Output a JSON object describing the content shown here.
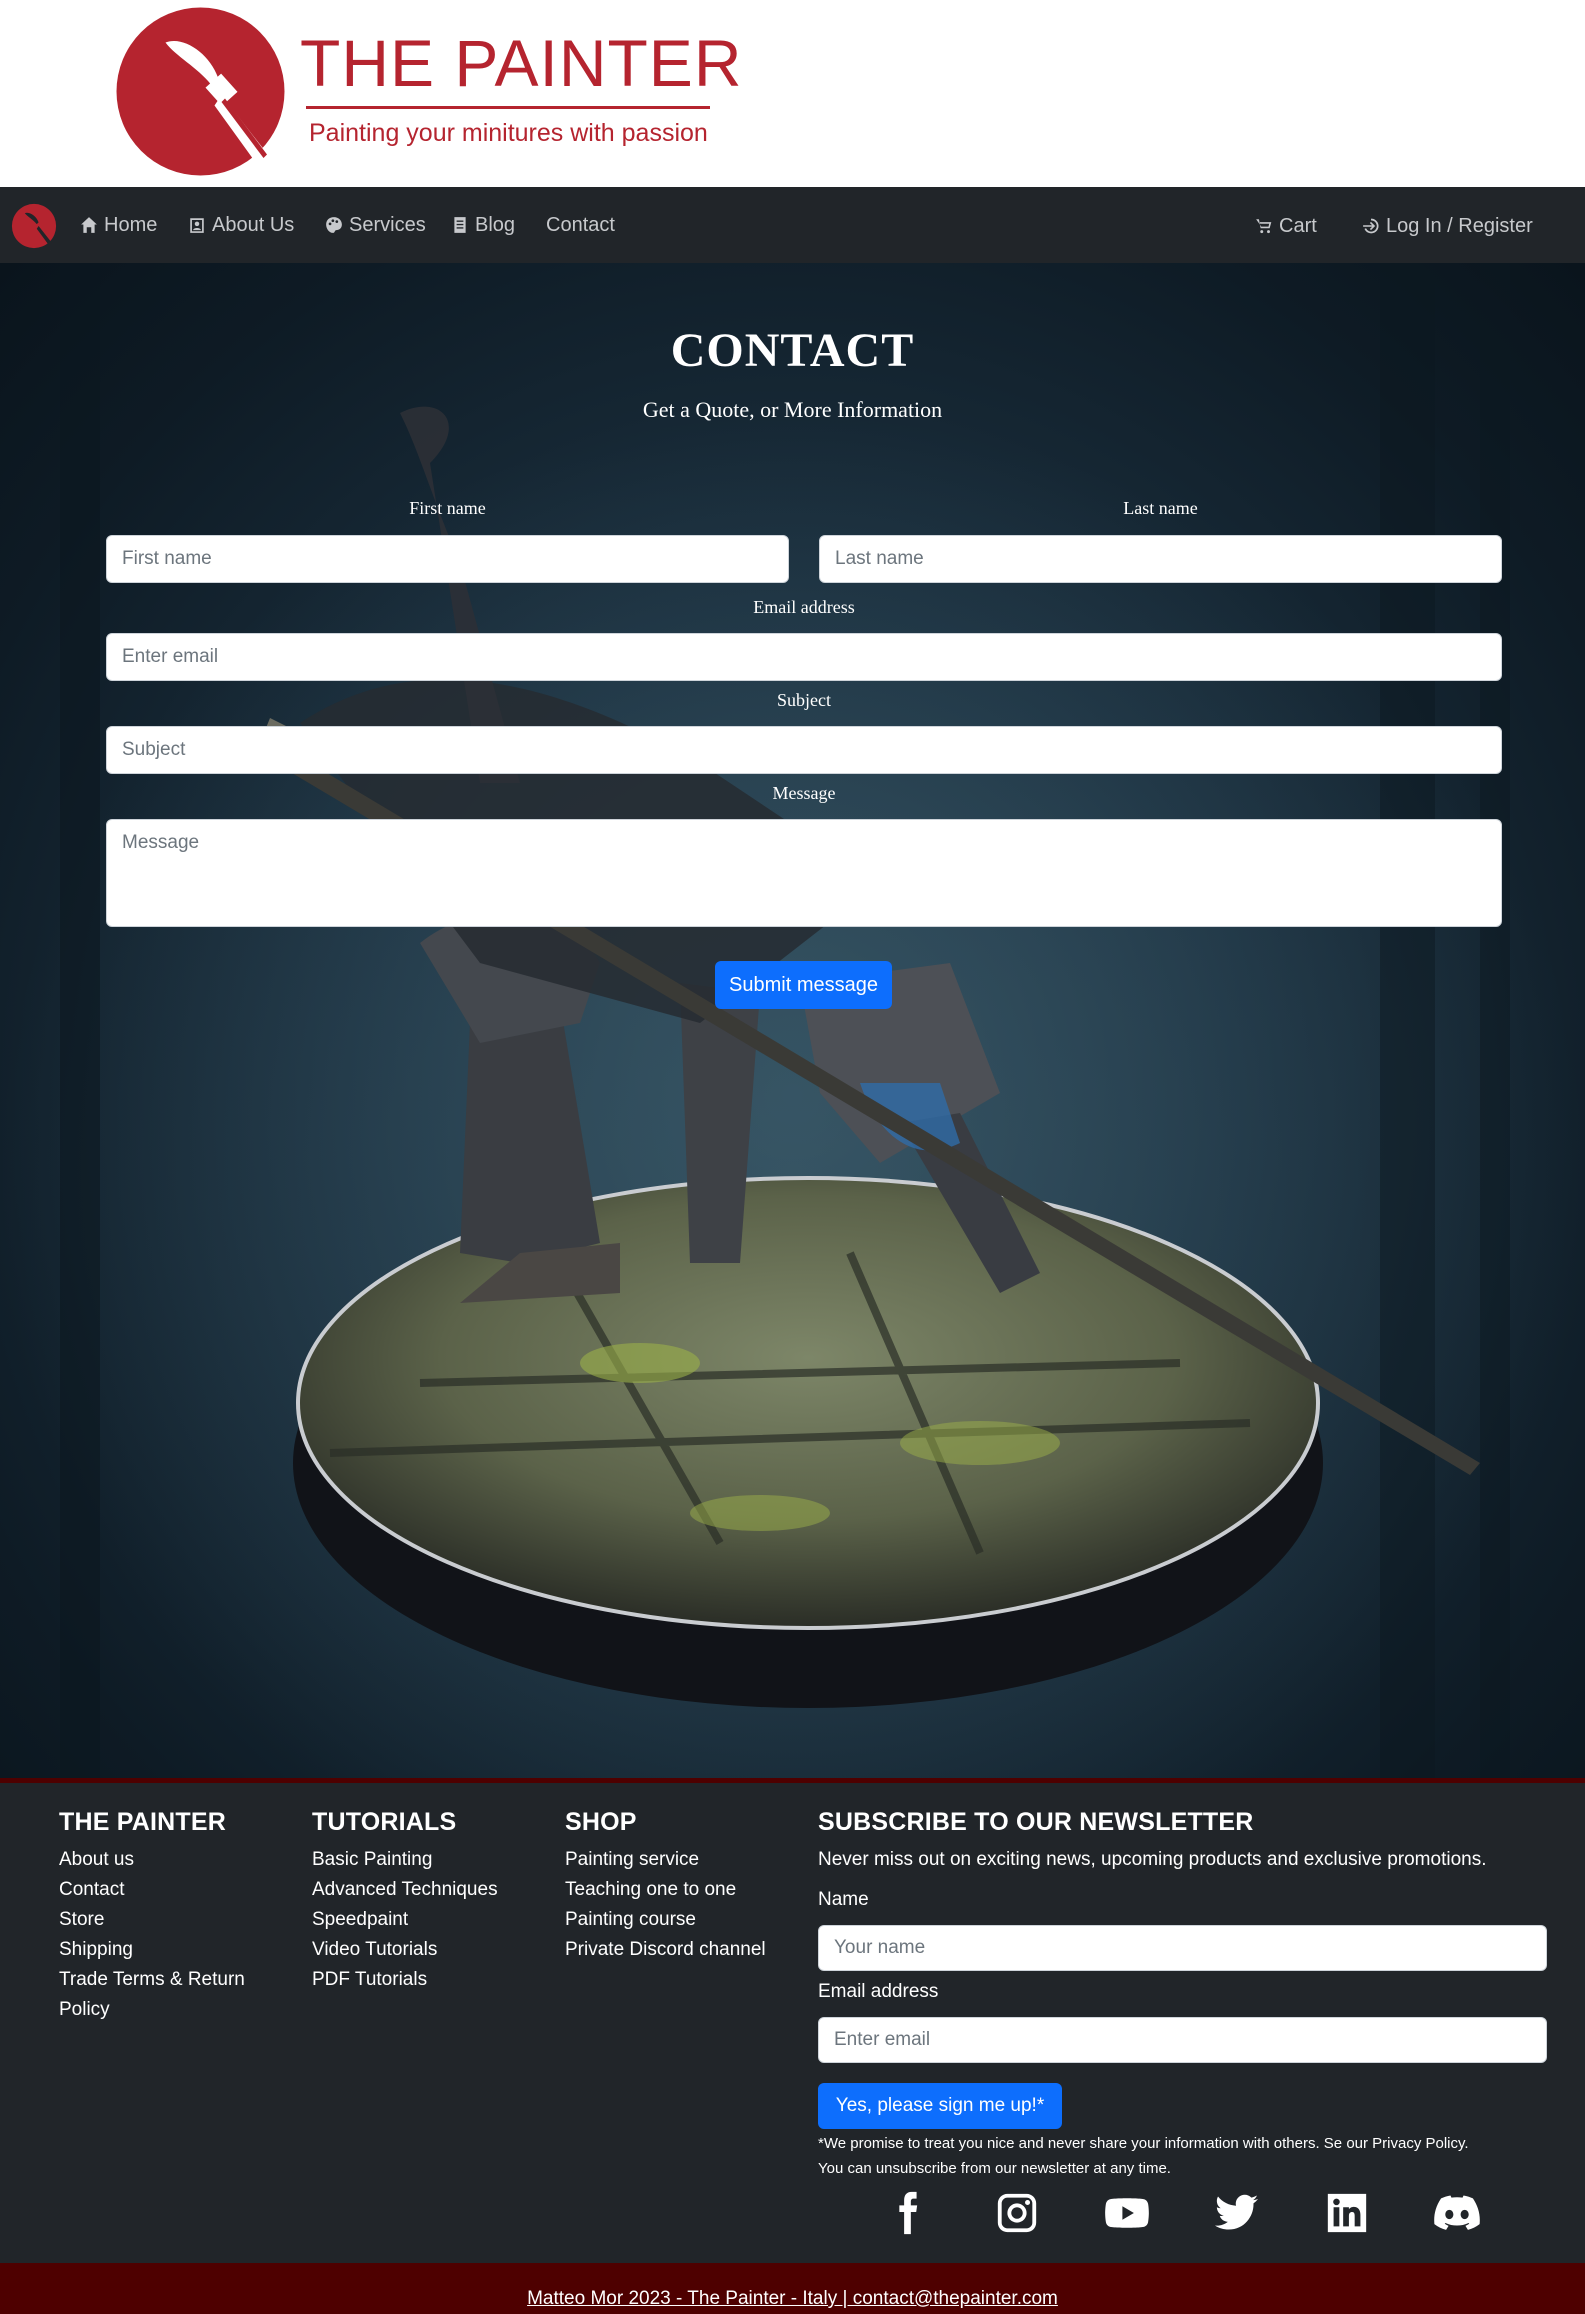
{
  "brand": {
    "title": "THE PAINTER",
    "tagline": "Painting your minitures with passion",
    "color": "#b5242f"
  },
  "nav": {
    "items": [
      {
        "label": "Home",
        "icon": "home-icon"
      },
      {
        "label": "About Us",
        "icon": "person-badge-icon"
      },
      {
        "label": "Services",
        "icon": "palette-icon"
      },
      {
        "label": "Blog",
        "icon": "document-icon"
      },
      {
        "label": "Contact",
        "icon": ""
      }
    ],
    "cart": "Cart",
    "login": "Log In / Register"
  },
  "contact": {
    "title": "CONTACT",
    "subtitle": "Get a Quote, or More Information",
    "first_name_label": "First name",
    "first_name_placeholder": "First name",
    "last_name_label": "Last name",
    "last_name_placeholder": "Last name",
    "email_label": "Email address",
    "email_placeholder": "Enter email",
    "subject_label": "Subject",
    "subject_placeholder": "Subject",
    "message_label": "Message",
    "message_placeholder": "Message",
    "submit": "Submit message"
  },
  "footer": {
    "col1": {
      "title": "THE PAINTER",
      "links": [
        "About us",
        "Contact",
        "Store",
        "Shipping",
        "Trade Terms & Return",
        "Policy"
      ]
    },
    "col2": {
      "title": "TUTORIALS",
      "links": [
        "Basic Painting",
        "Advanced Techniques",
        "Speedpaint",
        "Video Tutorials",
        "PDF Tutorials"
      ]
    },
    "col3": {
      "title": "SHOP",
      "links": [
        "Painting service",
        "Teaching one to one",
        "Painting course",
        "Private Discord channel"
      ]
    },
    "newsletter": {
      "title": "SUBSCRIBE TO OUR NEWSLETTER",
      "text": "Never miss out on exciting news, upcoming products and exclusive promotions.",
      "name_label": "Name",
      "name_placeholder": "Your name",
      "email_label": "Email address",
      "email_placeholder": "Enter email",
      "button": "Yes, please sign me up!*",
      "note_line1": "*We promise to treat you nice and never share your information with others. Se our Privacy Policy.",
      "note_line2": "You can unsubscribe from our newsletter at any time."
    },
    "social": [
      "facebook-icon",
      "instagram-icon",
      "youtube-icon",
      "twitter-icon",
      "linkedin-icon",
      "discord-icon"
    ]
  },
  "copyright": "Matteo Mor 2023 - The Painter - Italy | contact@thepainter.com",
  "colors": {
    "primary": "#0d6efd",
    "dark": "#212529",
    "footer_border": "#4e0000"
  }
}
